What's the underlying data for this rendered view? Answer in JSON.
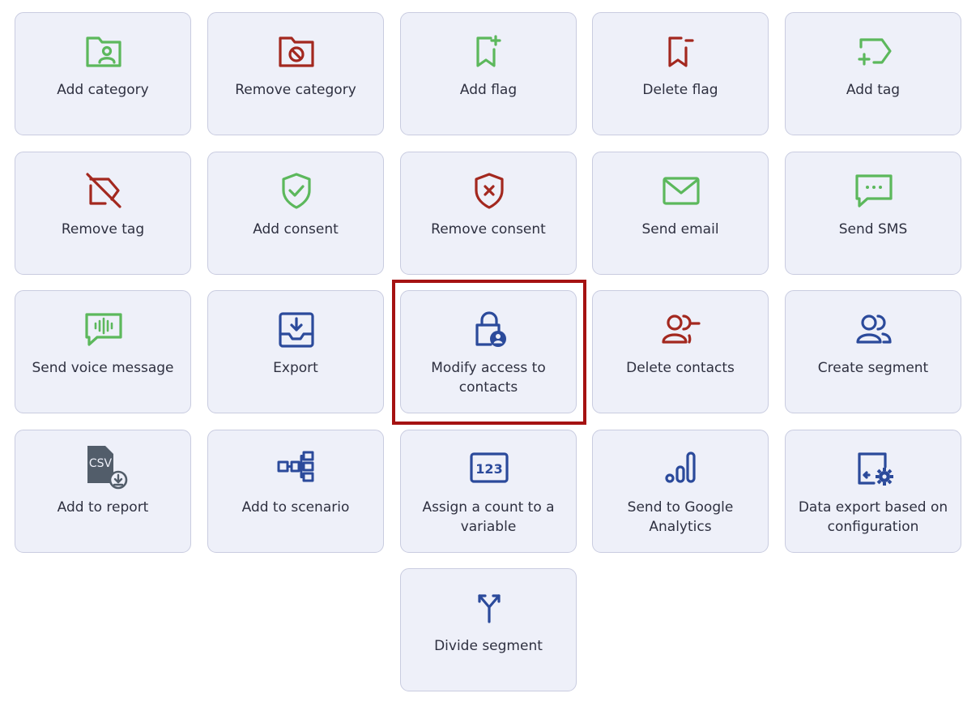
{
  "colors": {
    "green": "#5cb85c",
    "red": "#a3281f",
    "blue": "#2b4a9b",
    "gray": "#525d6a",
    "highlight": "#a51212"
  },
  "tiles": [
    {
      "label": "Add category",
      "icon": "folder-user-icon"
    },
    {
      "label": "Remove category",
      "icon": "folder-block-icon"
    },
    {
      "label": "Add flag",
      "icon": "flag-add-icon"
    },
    {
      "label": "Delete flag",
      "icon": "flag-remove-icon"
    },
    {
      "label": "Add tag",
      "icon": "tag-add-icon"
    },
    {
      "label": "Remove tag",
      "icon": "tag-off-icon"
    },
    {
      "label": "Add consent",
      "icon": "shield-check-icon"
    },
    {
      "label": "Remove consent",
      "icon": "shield-x-icon"
    },
    {
      "label": "Send email",
      "icon": "envelope-icon"
    },
    {
      "label": "Send SMS",
      "icon": "chat-dots-icon"
    },
    {
      "label": "Send voice message",
      "icon": "voice-wave-icon"
    },
    {
      "label": "Export",
      "icon": "tray-download-icon"
    },
    {
      "label": "Modify access to contacts",
      "icon": "lock-user-icon"
    },
    {
      "label": "Delete contacts",
      "icon": "users-minus-icon"
    },
    {
      "label": "Create segment",
      "icon": "users-icon"
    },
    {
      "label": "Add to report",
      "icon": "csv-file-icon",
      "icon_text": "CSV"
    },
    {
      "label": "Add to scenario",
      "icon": "flow-tree-icon"
    },
    {
      "label": "Assign a count to a variable",
      "icon": "counter-123-icon",
      "icon_text": "123"
    },
    {
      "label": "Send to Google Analytics",
      "icon": "analytics-bars-icon"
    },
    {
      "label": "Data export based on configuration",
      "icon": "export-gear-icon"
    },
    {
      "label": "Divide segment",
      "icon": "split-arrows-icon"
    }
  ]
}
